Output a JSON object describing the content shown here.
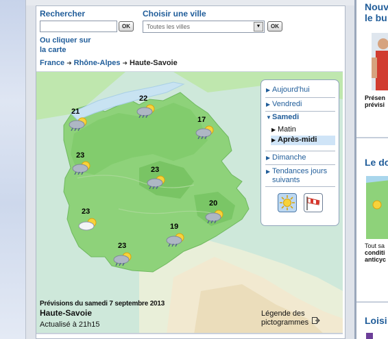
{
  "search": {
    "label": "Rechercher",
    "input_value": "",
    "ok_label": "OK"
  },
  "city": {
    "label": "Choisir une ville",
    "selected": "Toutes les villes",
    "ok_label": "OK"
  },
  "map_link": {
    "line1": "Ou cliquer sur",
    "line2": "la carte"
  },
  "breadcrumb": {
    "items": [
      "France",
      "Rhône-Alpes",
      "Haute-Savoie"
    ]
  },
  "forecast_points": [
    {
      "temp": "21",
      "icon": "sun-cloud-rain-icon"
    },
    {
      "temp": "22",
      "icon": "sun-cloud-rain-icon"
    },
    {
      "temp": "17",
      "icon": "sun-cloud-rain-icon"
    },
    {
      "temp": "23",
      "icon": "sun-cloud-rain-icon"
    },
    {
      "temp": "23",
      "icon": "sun-cloud-rain-icon"
    },
    {
      "temp": "23",
      "icon": "sun-cloud-icon"
    },
    {
      "temp": "20",
      "icon": "sun-cloud-rain-icon"
    },
    {
      "temp": "19",
      "icon": "sun-cloud-rain-icon"
    },
    {
      "temp": "23",
      "icon": "sun-cloud-rain-icon"
    }
  ],
  "menu": {
    "today": "Aujourd'hui",
    "friday": "Vendredi",
    "saturday": "Samedi",
    "morning": "Matin",
    "afternoon": "Après-midi",
    "sunday": "Dimanche",
    "trends_line1": "Tendances jours",
    "trends_line2": "suivants"
  },
  "view_buttons": [
    {
      "icon": "sun-icon",
      "active": true
    },
    {
      "icon": "windsock-icon",
      "active": false
    }
  ],
  "footer": {
    "title": "Prévisions du samedi 7 septembre 2013",
    "region": "Haute-Savoie",
    "updated": "Actualisé à 21h15",
    "legend_line1": "Légende des",
    "legend_line2": "pictogrammes"
  },
  "right_column": {
    "heading1_line1": "Nouv",
    "heading1_line2": "le bu",
    "text1_line1": "Présen",
    "text1_line2": "prévisi",
    "heading2": "Le do",
    "text2_line1": "Tout sa",
    "text2_line2": "conditi",
    "text2_line3": "anticyc",
    "heading3": "Loisi"
  },
  "colors": {
    "link_blue": "#1f5c99",
    "land_green": "#8ed27a",
    "sea_blue": "#c8e3f2",
    "active_bg": "#cfe4f7"
  }
}
